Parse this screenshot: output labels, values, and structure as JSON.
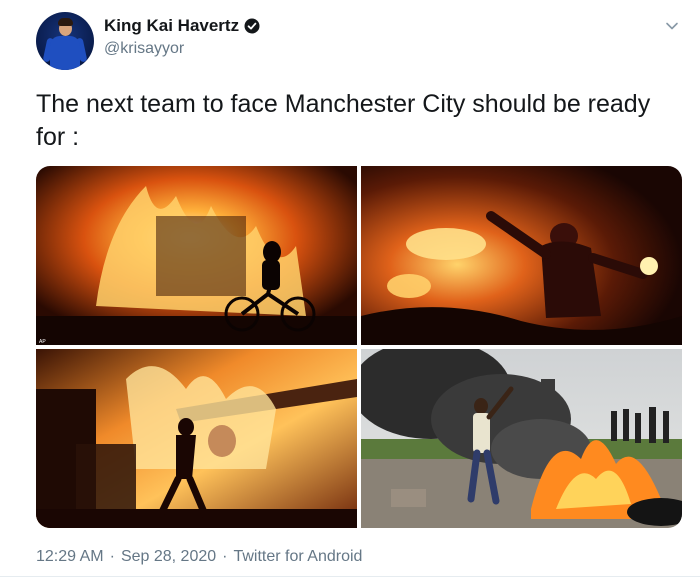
{
  "tweet": {
    "display_name": "King Kai Havertz",
    "handle": "@krisayyor",
    "text": "The next team to face Manchester City should be ready for :",
    "time": "12:29 AM",
    "separator": "·",
    "date": "Sep 28, 2020",
    "source": "Twitter for Android",
    "photo_credit": "AP"
  },
  "icons": {
    "verified": "verified-badge-icon",
    "caret": "chevron-down-icon"
  },
  "colors": {
    "text": "#14171a",
    "secondary": "#657786",
    "fire": "#ff7a1a"
  }
}
